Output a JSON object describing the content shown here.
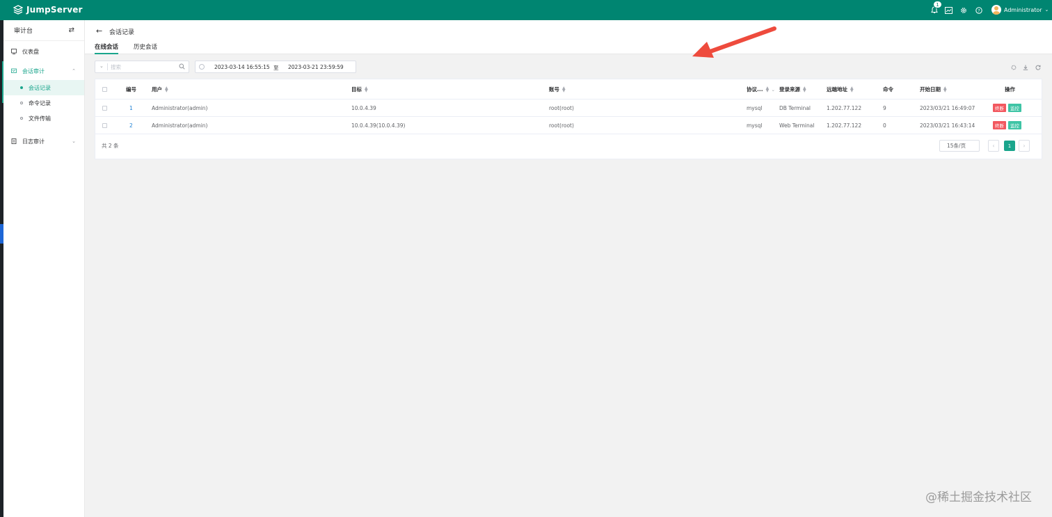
{
  "app": {
    "logo_text": "JumpServer"
  },
  "topbar": {
    "notification_count": "1",
    "user_name": "Administrator"
  },
  "sidebar": {
    "title": "审计台",
    "items": [
      {
        "label": "仪表盘"
      },
      {
        "label": "会话审计"
      },
      {
        "label": "日志审计"
      }
    ],
    "sub_items": [
      {
        "label": "会话记录"
      },
      {
        "label": "命令记录"
      },
      {
        "label": "文件传输"
      }
    ]
  },
  "page": {
    "title": "会话记录",
    "tabs": [
      {
        "label": "在线会话"
      },
      {
        "label": "历史会话"
      }
    ]
  },
  "filters": {
    "search_placeholder": "搜索",
    "date_start": "2023-03-14 16:55:15",
    "date_separator": "至",
    "date_end": "2023-03-21 23:59:59"
  },
  "table": {
    "columns": [
      {
        "label": "编号"
      },
      {
        "label": "用户"
      },
      {
        "label": "目标"
      },
      {
        "label": "账号"
      },
      {
        "label": "协议..."
      },
      {
        "label": "登录来源"
      },
      {
        "label": "远端地址"
      },
      {
        "label": "命令"
      },
      {
        "label": "开始日期"
      },
      {
        "label": "操作"
      }
    ],
    "rows": [
      {
        "id": "1",
        "user": "Administrator(admin)",
        "target": "10.0.4.39",
        "account": "root(root)",
        "protocol": "mysql",
        "source": "DB Terminal",
        "remote": "1.202.77.122",
        "commands": "9",
        "start": "2023/03/21 16:49:07",
        "action_terminate": "终断",
        "action_monitor": "监控"
      },
      {
        "id": "2",
        "user": "Administrator(admin)",
        "target": "10.0.4.39(10.0.4.39)",
        "account": "root(root)",
        "protocol": "mysql",
        "source": "Web Terminal",
        "remote": "1.202.77.122",
        "commands": "0",
        "start": "2023/03/21 16:43:14",
        "action_terminate": "终断",
        "action_monitor": "监控"
      }
    ]
  },
  "pagination": {
    "total": "共 2 条",
    "page_size": "15条/页",
    "current_page": "1"
  },
  "watermark": "@稀土掘金技术社区",
  "colors": {
    "brand": "#008571",
    "accent": "#1aa58c",
    "danger": "#f2585f",
    "annotation": "#ee4b3d"
  }
}
